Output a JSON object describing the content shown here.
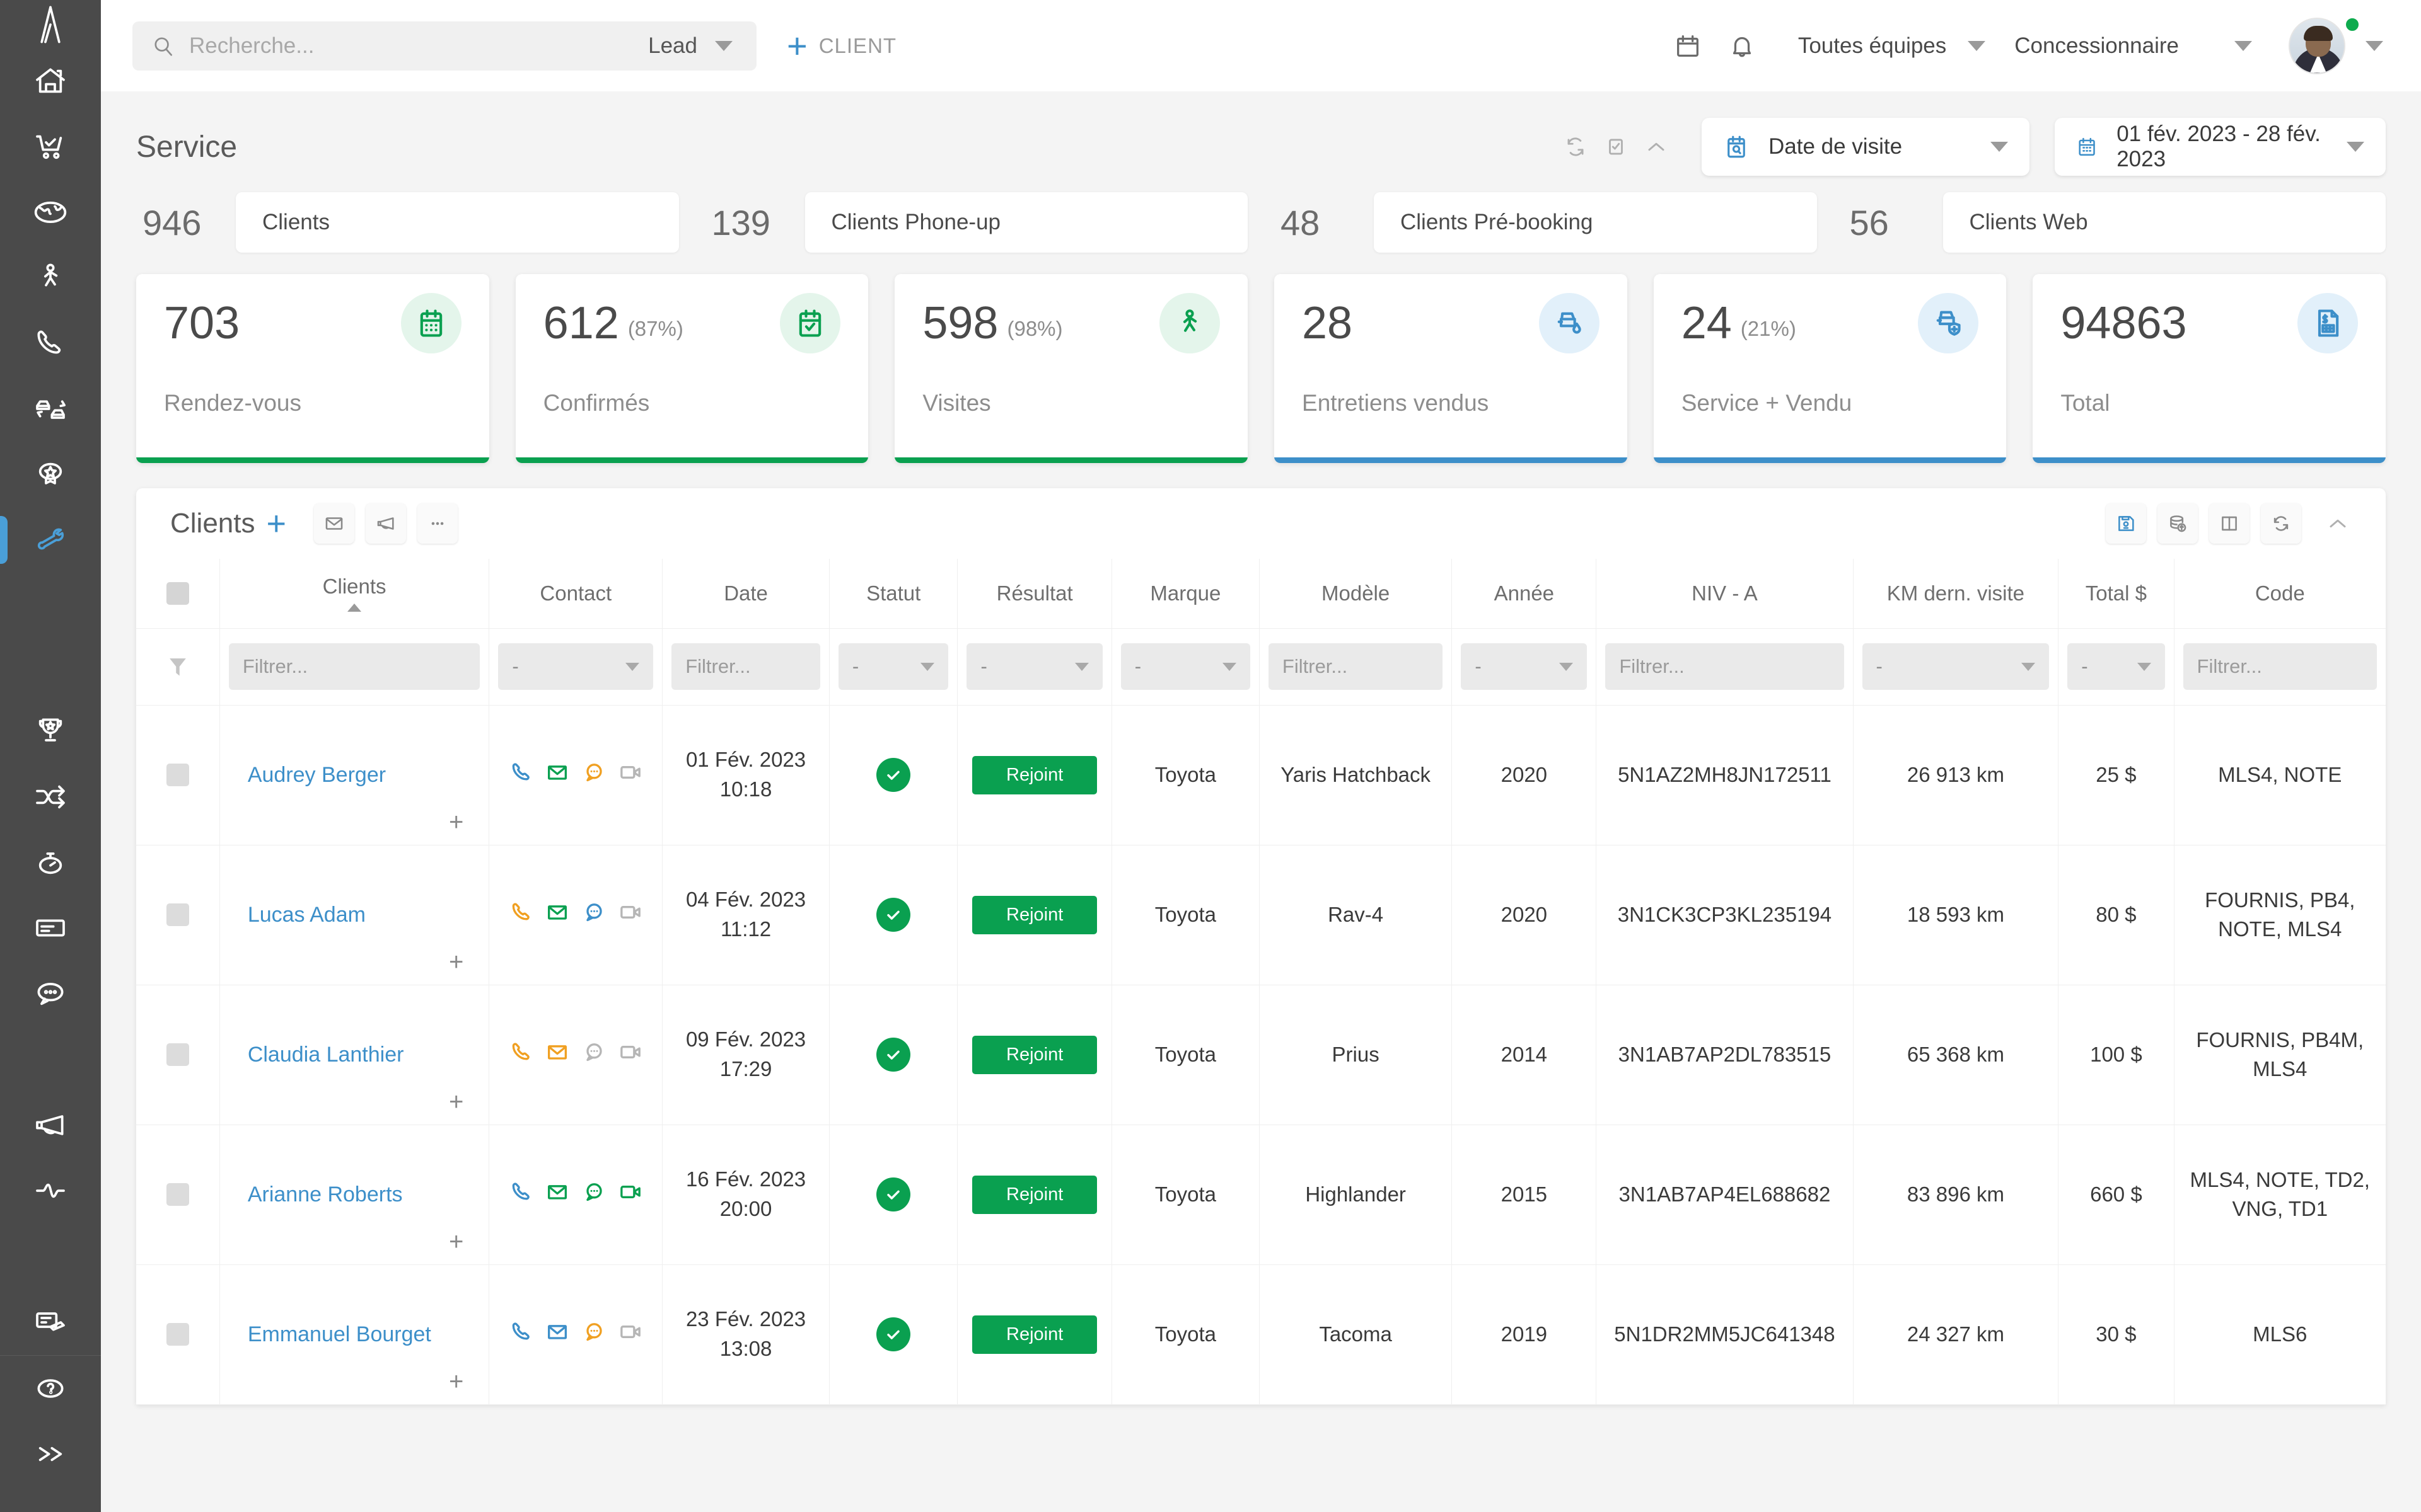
{
  "brand": {
    "accent_blue": "#3d8fc9",
    "accent_green": "#0aa050",
    "sidebar_bg": "#4a4a4a",
    "orange": "#f0a022"
  },
  "sidebar": {
    "logo": "logo-a",
    "items": [
      {
        "name": "home",
        "icon": "home-icon",
        "active": false
      },
      {
        "name": "sales",
        "icon": "shopping-cart-check-icon",
        "active": false
      },
      {
        "name": "web",
        "icon": "globe-icon",
        "active": false
      },
      {
        "name": "walkin",
        "icon": "walking-person-icon",
        "active": false
      },
      {
        "name": "phone",
        "icon": "phone-icon",
        "active": false
      },
      {
        "name": "trade",
        "icon": "car-exchange-icon",
        "active": false
      },
      {
        "name": "loyalty",
        "icon": "badge-star-icon",
        "active": false
      },
      {
        "name": "service",
        "icon": "wrench-icon",
        "active": true
      },
      {
        "name": "leaderboard",
        "icon": "trophy-icon",
        "active": false
      },
      {
        "name": "workflow",
        "icon": "shuffle-arrows-icon",
        "active": false
      },
      {
        "name": "activity-timer",
        "icon": "stopwatch-icon",
        "active": false
      },
      {
        "name": "forms",
        "icon": "card-icon",
        "active": false
      },
      {
        "name": "chat",
        "icon": "chat-bubble-icon",
        "active": false
      },
      {
        "name": "campaigns",
        "icon": "megaphone-icon",
        "active": false
      },
      {
        "name": "analytics",
        "icon": "pulse-wave-icon",
        "active": false
      },
      {
        "name": "esign",
        "icon": "signature-icon",
        "active": false
      }
    ],
    "bottom_items": [
      {
        "name": "help",
        "icon": "question-circle-icon"
      },
      {
        "name": "expand",
        "icon": "double-chevron-right-icon"
      }
    ]
  },
  "topbar": {
    "search": {
      "placeholder": "Recherche...",
      "value": "",
      "icon": "search-icon"
    },
    "scope_label": "Lead",
    "add_client_label": "CLIENT",
    "calendar_icon": "calendar-icon",
    "bell_icon": "bell-icon",
    "team_selector": "Toutes équipes",
    "role_selector": "Concessionnaire",
    "avatar": "user-avatar",
    "status": "online"
  },
  "section": {
    "title": "Service",
    "tools": [
      {
        "name": "refresh",
        "icon": "refresh-icon"
      },
      {
        "name": "select-mode",
        "icon": "checkbox-icon"
      },
      {
        "name": "collapse",
        "icon": "chevron-up-icon"
      }
    ],
    "date_type_filter": {
      "label": "Date de visite",
      "icon": "calendar-search-icon"
    },
    "date_range_filter": {
      "label": "01 fév. 2023 - 28 fév. 2023",
      "icon": "calendar-icon"
    }
  },
  "mini_kpis": [
    {
      "value": "946",
      "label": "Clients"
    },
    {
      "value": "139",
      "label": "Clients Phone-up"
    },
    {
      "value": "48",
      "label": "Clients Pré-booking"
    },
    {
      "value": "56",
      "label": "Clients Web"
    }
  ],
  "kpi_cards": [
    {
      "value": "703",
      "pct": "",
      "label": "Rendez-vous",
      "icon": "calendar-icon",
      "color": "green"
    },
    {
      "value": "612",
      "pct": "(87%)",
      "label": "Confirmés",
      "icon": "calendar-check-icon",
      "color": "green"
    },
    {
      "value": "598",
      "pct": "(98%)",
      "label": "Visites",
      "icon": "walking-person-icon",
      "color": "green"
    },
    {
      "value": "28",
      "pct": "",
      "label": "Entretiens vendus",
      "icon": "car-oil-drop-icon",
      "color": "blue"
    },
    {
      "value": "24",
      "pct": "(21%)",
      "label": "Service + Vendu",
      "icon": "car-shield-plus-icon",
      "color": "blue"
    },
    {
      "value": "94863",
      "pct": "",
      "label": "Total",
      "icon": "invoice-dollar-icon",
      "color": "blue"
    }
  ],
  "table_panel": {
    "title": "Clients",
    "add_icon": "plus-icon",
    "left_tools": [
      {
        "name": "email",
        "icon": "envelope-icon"
      },
      {
        "name": "broadcast",
        "icon": "megaphone-icon"
      },
      {
        "name": "more",
        "icon": "ellipsis-icon"
      }
    ],
    "right_tools": [
      {
        "name": "save-view",
        "icon": "floppy-disk-icon",
        "accent": true
      },
      {
        "name": "export-data",
        "icon": "database-upload-icon",
        "accent": false
      },
      {
        "name": "columns",
        "icon": "columns-icon",
        "accent": false
      },
      {
        "name": "refresh",
        "icon": "refresh-icon",
        "accent": false
      }
    ],
    "collapse_icon": "chevron-up-icon",
    "columns": [
      {
        "key": "check",
        "label": "",
        "filter": "checkbox"
      },
      {
        "key": "clients",
        "label": "Clients",
        "filter": "text",
        "placeholder": "Filtrer...",
        "sorted": "asc"
      },
      {
        "key": "contact",
        "label": "Contact",
        "filter": "select",
        "placeholder": "-"
      },
      {
        "key": "date",
        "label": "Date",
        "filter": "text",
        "placeholder": "Filtrer..."
      },
      {
        "key": "statut",
        "label": "Statut",
        "filter": "select",
        "placeholder": "-"
      },
      {
        "key": "resultat",
        "label": "Résultat",
        "filter": "select",
        "placeholder": "-"
      },
      {
        "key": "marque",
        "label": "Marque",
        "filter": "select",
        "placeholder": "-"
      },
      {
        "key": "modele",
        "label": "Modèle",
        "filter": "text",
        "placeholder": "Filtrer..."
      },
      {
        "key": "annee",
        "label": "Année",
        "filter": "select",
        "placeholder": "-"
      },
      {
        "key": "niv",
        "label": "NIV - A",
        "filter": "text",
        "placeholder": "Filtrer..."
      },
      {
        "key": "km",
        "label": "KM dern. visite",
        "filter": "select",
        "placeholder": "-"
      },
      {
        "key": "total",
        "label": "Total $",
        "filter": "select",
        "placeholder": "-"
      },
      {
        "key": "code",
        "label": "Code",
        "filter": "text",
        "placeholder": "Filtrer..."
      }
    ],
    "rows": [
      {
        "client": "Audrey Berger",
        "contact": {
          "phone": "blue",
          "email": "green",
          "sms": "orange",
          "video": "gray"
        },
        "date": "01 Fév. 2023",
        "time": "10:18",
        "statut": "check",
        "resultat": "Rejoint",
        "marque": "Toyota",
        "modele": "Yaris Hatchback",
        "annee": "2020",
        "niv": "5N1AZ2MH8JN172511",
        "km": "26 913 km",
        "total": "25 $",
        "code": "MLS4, NOTE"
      },
      {
        "client": "Lucas Adam",
        "contact": {
          "phone": "orange",
          "email": "green",
          "sms": "blue",
          "video": "gray"
        },
        "date": "04 Fév. 2023",
        "time": "11:12",
        "statut": "check",
        "resultat": "Rejoint",
        "marque": "Toyota",
        "modele": "Rav-4",
        "annee": "2020",
        "niv": "3N1CK3CP3KL235194",
        "km": "18 593 km",
        "total": "80 $",
        "code": "FOURNIS, PB4, NOTE, MLS4"
      },
      {
        "client": "Claudia Lanthier",
        "contact": {
          "phone": "orange",
          "email": "orange",
          "sms": "gray",
          "video": "gray"
        },
        "date": "09 Fév. 2023",
        "time": "17:29",
        "statut": "check",
        "resultat": "Rejoint",
        "marque": "Toyota",
        "modele": "Prius",
        "annee": "2014",
        "niv": "3N1AB7AP2DL783515",
        "km": "65 368 km",
        "total": "100 $",
        "code": "FOURNIS, PB4M, MLS4"
      },
      {
        "client": "Arianne Roberts",
        "contact": {
          "phone": "blue",
          "email": "green",
          "sms": "green",
          "video": "green"
        },
        "date": "16 Fév. 2023",
        "time": "20:00",
        "statut": "check",
        "resultat": "Rejoint",
        "marque": "Toyota",
        "modele": "Highlander",
        "annee": "2015",
        "niv": "3N1AB7AP4EL688682",
        "km": "83 896 km",
        "total": "660 $",
        "code": "MLS4, NOTE, TD2, VNG, TD1"
      },
      {
        "client": "Emmanuel Bourget",
        "contact": {
          "phone": "blue",
          "email": "blue",
          "sms": "orange",
          "video": "gray"
        },
        "date": "23 Fév. 2023",
        "time": "13:08",
        "statut": "check",
        "resultat": "Rejoint",
        "marque": "Toyota",
        "modele": "Tacoma",
        "annee": "2019",
        "niv": "5N1DR2MM5JC641348",
        "km": "24 327 km",
        "total": "30 $",
        "code": "MLS6"
      }
    ]
  }
}
